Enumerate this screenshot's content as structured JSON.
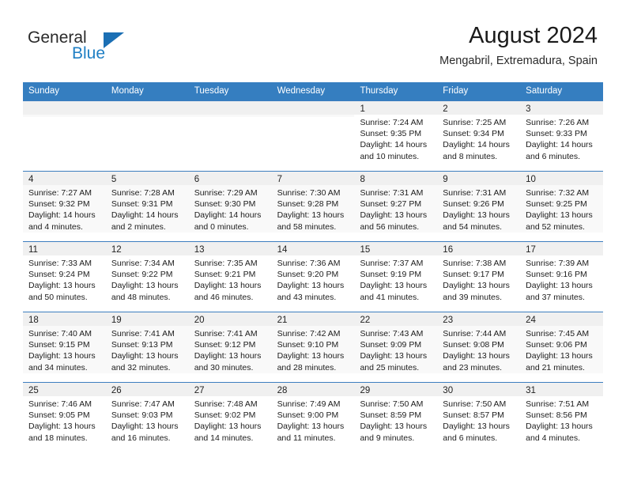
{
  "brand": {
    "line1": "General",
    "line2": "Blue",
    "triangle_color": "#1b6fb4",
    "text_color": "#2b2b2b",
    "blue_color": "#1f7fc4"
  },
  "header": {
    "title": "August 2024",
    "subtitle": "Mengabril, Extremadura, Spain"
  },
  "theme": {
    "header_band": "#357ec0",
    "cell_top_border": "#3d7ebf",
    "day_num_bg": "#f0f0f0",
    "shaded_row_bg": "#f9f9f9"
  },
  "weekdays": [
    "Sunday",
    "Monday",
    "Tuesday",
    "Wednesday",
    "Thursday",
    "Friday",
    "Saturday"
  ],
  "labels": {
    "sunrise_prefix": "Sunrise:",
    "sunset_prefix": "Sunset:",
    "daylight_prefix": "Daylight:"
  },
  "weeks": [
    {
      "shaded": false,
      "days": [
        {
          "empty": true
        },
        {
          "empty": true
        },
        {
          "empty": true
        },
        {
          "empty": true
        },
        {
          "empty": false,
          "num": "1",
          "l1": "Sunrise: 7:24 AM",
          "l2": "Sunset: 9:35 PM",
          "l3": "Daylight: 14 hours",
          "l4": "and 10 minutes."
        },
        {
          "empty": false,
          "num": "2",
          "l1": "Sunrise: 7:25 AM",
          "l2": "Sunset: 9:34 PM",
          "l3": "Daylight: 14 hours",
          "l4": "and 8 minutes."
        },
        {
          "empty": false,
          "num": "3",
          "l1": "Sunrise: 7:26 AM",
          "l2": "Sunset: 9:33 PM",
          "l3": "Daylight: 14 hours",
          "l4": "and 6 minutes."
        }
      ]
    },
    {
      "shaded": true,
      "days": [
        {
          "empty": false,
          "num": "4",
          "l1": "Sunrise: 7:27 AM",
          "l2": "Sunset: 9:32 PM",
          "l3": "Daylight: 14 hours",
          "l4": "and 4 minutes."
        },
        {
          "empty": false,
          "num": "5",
          "l1": "Sunrise: 7:28 AM",
          "l2": "Sunset: 9:31 PM",
          "l3": "Daylight: 14 hours",
          "l4": "and 2 minutes."
        },
        {
          "empty": false,
          "num": "6",
          "l1": "Sunrise: 7:29 AM",
          "l2": "Sunset: 9:30 PM",
          "l3": "Daylight: 14 hours",
          "l4": "and 0 minutes."
        },
        {
          "empty": false,
          "num": "7",
          "l1": "Sunrise: 7:30 AM",
          "l2": "Sunset: 9:28 PM",
          "l3": "Daylight: 13 hours",
          "l4": "and 58 minutes."
        },
        {
          "empty": false,
          "num": "8",
          "l1": "Sunrise: 7:31 AM",
          "l2": "Sunset: 9:27 PM",
          "l3": "Daylight: 13 hours",
          "l4": "and 56 minutes."
        },
        {
          "empty": false,
          "num": "9",
          "l1": "Sunrise: 7:31 AM",
          "l2": "Sunset: 9:26 PM",
          "l3": "Daylight: 13 hours",
          "l4": "and 54 minutes."
        },
        {
          "empty": false,
          "num": "10",
          "l1": "Sunrise: 7:32 AM",
          "l2": "Sunset: 9:25 PM",
          "l3": "Daylight: 13 hours",
          "l4": "and 52 minutes."
        }
      ]
    },
    {
      "shaded": false,
      "days": [
        {
          "empty": false,
          "num": "11",
          "l1": "Sunrise: 7:33 AM",
          "l2": "Sunset: 9:24 PM",
          "l3": "Daylight: 13 hours",
          "l4": "and 50 minutes."
        },
        {
          "empty": false,
          "num": "12",
          "l1": "Sunrise: 7:34 AM",
          "l2": "Sunset: 9:22 PM",
          "l3": "Daylight: 13 hours",
          "l4": "and 48 minutes."
        },
        {
          "empty": false,
          "num": "13",
          "l1": "Sunrise: 7:35 AM",
          "l2": "Sunset: 9:21 PM",
          "l3": "Daylight: 13 hours",
          "l4": "and 46 minutes."
        },
        {
          "empty": false,
          "num": "14",
          "l1": "Sunrise: 7:36 AM",
          "l2": "Sunset: 9:20 PM",
          "l3": "Daylight: 13 hours",
          "l4": "and 43 minutes."
        },
        {
          "empty": false,
          "num": "15",
          "l1": "Sunrise: 7:37 AM",
          "l2": "Sunset: 9:19 PM",
          "l3": "Daylight: 13 hours",
          "l4": "and 41 minutes."
        },
        {
          "empty": false,
          "num": "16",
          "l1": "Sunrise: 7:38 AM",
          "l2": "Sunset: 9:17 PM",
          "l3": "Daylight: 13 hours",
          "l4": "and 39 minutes."
        },
        {
          "empty": false,
          "num": "17",
          "l1": "Sunrise: 7:39 AM",
          "l2": "Sunset: 9:16 PM",
          "l3": "Daylight: 13 hours",
          "l4": "and 37 minutes."
        }
      ]
    },
    {
      "shaded": true,
      "days": [
        {
          "empty": false,
          "num": "18",
          "l1": "Sunrise: 7:40 AM",
          "l2": "Sunset: 9:15 PM",
          "l3": "Daylight: 13 hours",
          "l4": "and 34 minutes."
        },
        {
          "empty": false,
          "num": "19",
          "l1": "Sunrise: 7:41 AM",
          "l2": "Sunset: 9:13 PM",
          "l3": "Daylight: 13 hours",
          "l4": "and 32 minutes."
        },
        {
          "empty": false,
          "num": "20",
          "l1": "Sunrise: 7:41 AM",
          "l2": "Sunset: 9:12 PM",
          "l3": "Daylight: 13 hours",
          "l4": "and 30 minutes."
        },
        {
          "empty": false,
          "num": "21",
          "l1": "Sunrise: 7:42 AM",
          "l2": "Sunset: 9:10 PM",
          "l3": "Daylight: 13 hours",
          "l4": "and 28 minutes."
        },
        {
          "empty": false,
          "num": "22",
          "l1": "Sunrise: 7:43 AM",
          "l2": "Sunset: 9:09 PM",
          "l3": "Daylight: 13 hours",
          "l4": "and 25 minutes."
        },
        {
          "empty": false,
          "num": "23",
          "l1": "Sunrise: 7:44 AM",
          "l2": "Sunset: 9:08 PM",
          "l3": "Daylight: 13 hours",
          "l4": "and 23 minutes."
        },
        {
          "empty": false,
          "num": "24",
          "l1": "Sunrise: 7:45 AM",
          "l2": "Sunset: 9:06 PM",
          "l3": "Daylight: 13 hours",
          "l4": "and 21 minutes."
        }
      ]
    },
    {
      "shaded": false,
      "days": [
        {
          "empty": false,
          "num": "25",
          "l1": "Sunrise: 7:46 AM",
          "l2": "Sunset: 9:05 PM",
          "l3": "Daylight: 13 hours",
          "l4": "and 18 minutes."
        },
        {
          "empty": false,
          "num": "26",
          "l1": "Sunrise: 7:47 AM",
          "l2": "Sunset: 9:03 PM",
          "l3": "Daylight: 13 hours",
          "l4": "and 16 minutes."
        },
        {
          "empty": false,
          "num": "27",
          "l1": "Sunrise: 7:48 AM",
          "l2": "Sunset: 9:02 PM",
          "l3": "Daylight: 13 hours",
          "l4": "and 14 minutes."
        },
        {
          "empty": false,
          "num": "28",
          "l1": "Sunrise: 7:49 AM",
          "l2": "Sunset: 9:00 PM",
          "l3": "Daylight: 13 hours",
          "l4": "and 11 minutes."
        },
        {
          "empty": false,
          "num": "29",
          "l1": "Sunrise: 7:50 AM",
          "l2": "Sunset: 8:59 PM",
          "l3": "Daylight: 13 hours",
          "l4": "and 9 minutes."
        },
        {
          "empty": false,
          "num": "30",
          "l1": "Sunrise: 7:50 AM",
          "l2": "Sunset: 8:57 PM",
          "l3": "Daylight: 13 hours",
          "l4": "and 6 minutes."
        },
        {
          "empty": false,
          "num": "31",
          "l1": "Sunrise: 7:51 AM",
          "l2": "Sunset: 8:56 PM",
          "l3": "Daylight: 13 hours",
          "l4": "and 4 minutes."
        }
      ]
    }
  ]
}
